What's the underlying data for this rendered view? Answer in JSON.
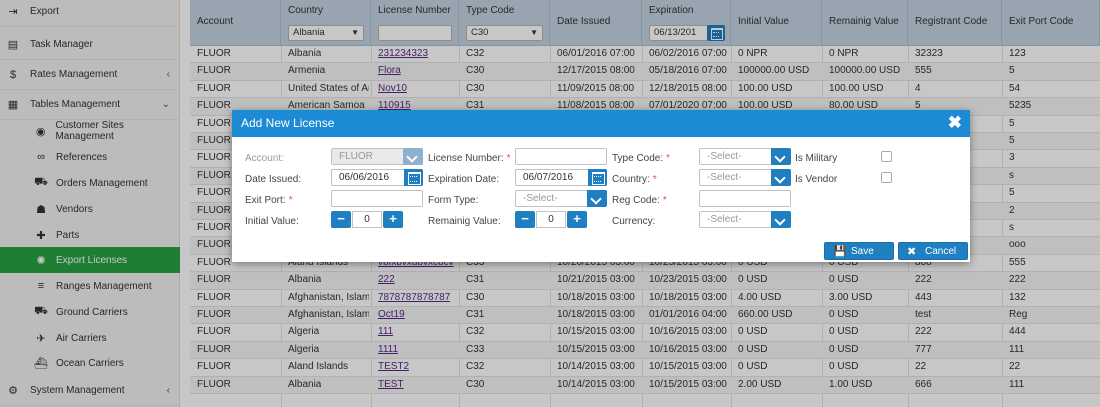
{
  "sidebar": {
    "items": [
      {
        "label": "Export",
        "icon": "export-icon",
        "glyph": "⇥"
      },
      {
        "label": "Task Manager",
        "icon": "task-manager-icon",
        "glyph": "▤"
      },
      {
        "label": "Rates Management",
        "icon": "dollar-icon",
        "glyph": "$",
        "chevron": "‹"
      },
      {
        "label": "Tables Management",
        "icon": "table-icon",
        "glyph": "▦",
        "chevron": "⌄"
      },
      {
        "label": "Customer Sites Management",
        "icon": "globe-icon",
        "glyph": "◉"
      },
      {
        "label": "References",
        "icon": "link-icon",
        "glyph": "∞"
      },
      {
        "label": "Orders Management",
        "icon": "cart-icon",
        "glyph": "⛟"
      },
      {
        "label": "Vendors",
        "icon": "users-icon",
        "glyph": "☗"
      },
      {
        "label": "Parts",
        "icon": "puzzle-icon",
        "glyph": "✚"
      },
      {
        "label": "Export Licenses",
        "icon": "gear-icon",
        "glyph": "✺",
        "active": true
      },
      {
        "label": "Ranges Management",
        "icon": "sliders-icon",
        "glyph": "≡"
      },
      {
        "label": "Ground Carriers",
        "icon": "truck-icon",
        "glyph": "⛟"
      },
      {
        "label": "Air Carriers",
        "icon": "plane-icon",
        "glyph": "✈"
      },
      {
        "label": "Ocean Carriers",
        "icon": "ship-icon",
        "glyph": "⛴"
      },
      {
        "label": "System Management",
        "icon": "cogs-icon",
        "glyph": "⚙",
        "chevron": "‹"
      }
    ]
  },
  "grid": {
    "columns": [
      {
        "label": "Account"
      },
      {
        "label": "Country",
        "filter": "Albania",
        "filterType": "select"
      },
      {
        "label": "License Number",
        "filter": "",
        "filterType": "text"
      },
      {
        "label": "Type Code",
        "filter": "C30",
        "filterType": "select"
      },
      {
        "label": "Date Issued"
      },
      {
        "label": "Expiration",
        "filter": "06/13/201",
        "filterType": "date"
      },
      {
        "label": "Initial Value"
      },
      {
        "label": "Remainig Value"
      },
      {
        "label": "Registrant Code"
      },
      {
        "label": "Exit Port Code"
      }
    ],
    "rows": [
      [
        "FLUOR",
        "Albania",
        "231234323",
        "C32",
        "06/01/2016 07:00",
        "06/02/2016 07:00",
        "0 NPR",
        "0 NPR",
        "32323",
        "123"
      ],
      [
        "FLUOR",
        "Armenia",
        "Flora",
        "C30",
        "12/17/2015 08:00",
        "05/18/2016 07:00",
        "100000.00 USD",
        "100000.00 USD",
        "555",
        "5"
      ],
      [
        "FLUOR",
        "United States of Ame",
        "Nov10",
        "C30",
        "11/09/2015 08:00",
        "12/18/2015 08:00",
        "100.00 USD",
        "100.00 USD",
        "4",
        "54"
      ],
      [
        "FLUOR",
        "American Samoa",
        "110915",
        "C31",
        "11/08/2015 08:00",
        "07/01/2020 07:00",
        "100.00 USD",
        "80.00 USD",
        "5",
        "5235"
      ],
      [
        "FLUOR",
        "",
        "",
        "",
        "",
        "",
        "",
        "",
        "",
        "5"
      ],
      [
        "FLUOR",
        "",
        "",
        "",
        "",
        "",
        "",
        "",
        "",
        "5"
      ],
      [
        "FLUOR",
        "",
        "",
        "",
        "",
        "",
        "",
        "",
        "",
        "3"
      ],
      [
        "FLUOR",
        "",
        "",
        "",
        "",
        "",
        "",
        "",
        "",
        "s"
      ],
      [
        "FLUOR",
        "",
        "",
        "",
        "",
        "",
        "",
        "",
        "",
        "5"
      ],
      [
        "FLUOR",
        "",
        "",
        "",
        "",
        "",
        "",
        "",
        "",
        "2"
      ],
      [
        "FLUOR",
        "",
        "",
        "",
        "",
        "",
        "",
        "",
        "",
        "s"
      ],
      [
        "FLUOR",
        "",
        "",
        "",
        "",
        "",
        "",
        "",
        "",
        "ooo"
      ],
      [
        "FLUOR",
        "Aland Islands",
        "vbfxbvxdbvxcbcv",
        "C33",
        "10/20/2015 03:00",
        "10/25/2015 03:00",
        "0 USD",
        "0 USD",
        "888",
        "555"
      ],
      [
        "FLUOR",
        "Albania",
        "222",
        "C31",
        "10/21/2015 03:00",
        "10/23/2015 03:00",
        "0 USD",
        "0 USD",
        "222",
        "222"
      ],
      [
        "FLUOR",
        "Afghanistan, Islamic",
        "7878787878787",
        "C30",
        "10/18/2015 03:00",
        "10/18/2015 03:00",
        "4.00 USD",
        "3.00 USD",
        "443",
        "132"
      ],
      [
        "FLUOR",
        "Afghanistan, Islamic",
        "Oct19",
        "C31",
        "10/18/2015 03:00",
        "01/01/2016 04:00",
        "660.00 USD",
        "0 USD",
        "test",
        "Reg"
      ],
      [
        "FLUOR",
        "Algeria",
        "111",
        "C32",
        "10/15/2015 03:00",
        "10/16/2015 03:00",
        "0 USD",
        "0 USD",
        "222",
        "444"
      ],
      [
        "FLUOR",
        "Algeria",
        "1111",
        "C33",
        "10/15/2015 03:00",
        "10/16/2015 03:00",
        "0 USD",
        "0 USD",
        "777",
        "111"
      ],
      [
        "FLUOR",
        "Aland Islands",
        "TEST2",
        "C32",
        "10/14/2015 03:00",
        "10/15/2015 03:00",
        "0 USD",
        "0 USD",
        "22",
        "22"
      ],
      [
        "FLUOR",
        "Albania",
        "TEST",
        "C30",
        "10/14/2015 03:00",
        "10/15/2015 03:00",
        "2.00 USD",
        "1.00 USD",
        "666",
        "111"
      ]
    ]
  },
  "modal": {
    "title": "Add New License",
    "close_glyph": "✖",
    "fields": {
      "account": {
        "label": "Account:",
        "value": "FLUOR"
      },
      "license_number": {
        "label": "License Number:",
        "value": ""
      },
      "type_code": {
        "label": "Type Code:",
        "placeholder": "-Select-"
      },
      "is_military": {
        "label": "Is Military"
      },
      "date_issued": {
        "label": "Date Issued:",
        "value": "06/06/2016"
      },
      "expiration_date": {
        "label": "Expiration Date:",
        "value": "06/07/2016"
      },
      "country": {
        "label": "Country:",
        "placeholder": "-Select-"
      },
      "is_vendor": {
        "label": "Is Vendor"
      },
      "exit_port": {
        "label": "Exit Port:",
        "value": ""
      },
      "form_type": {
        "label": "Form Type:",
        "placeholder": "-Select-"
      },
      "reg_code": {
        "label": "Reg Code:",
        "value": ""
      },
      "initial_value": {
        "label": "Initial Value:",
        "value": "0"
      },
      "remaining_value": {
        "label": "Remainig Value:",
        "value": "0"
      },
      "currency": {
        "label": "Currency:",
        "placeholder": "-Select-"
      }
    },
    "required_mark": "*",
    "minus": "−",
    "plus": "+",
    "save_label": "Save",
    "save_glyph": "💾",
    "cancel_label": "Cancel",
    "cancel_glyph": "✖"
  }
}
